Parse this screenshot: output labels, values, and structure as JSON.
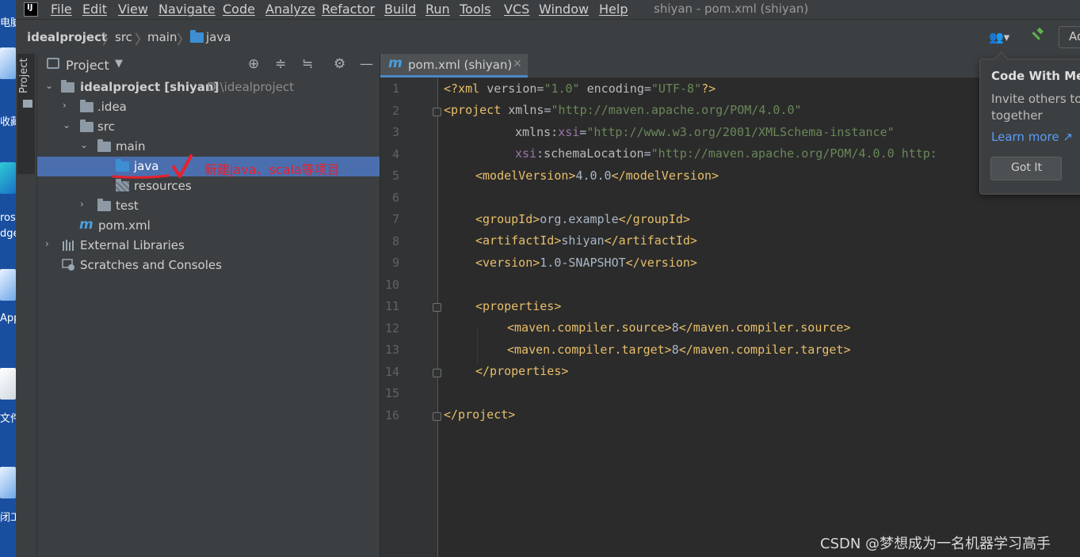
{
  "desktop": {
    "labels": [
      "电脑",
      "收藏",
      "ros",
      "dge",
      "App",
      "文件",
      "闭工"
    ]
  },
  "menubar": {
    "items": [
      "File",
      "Edit",
      "View",
      "Navigate",
      "Code",
      "Analyze",
      "Refactor",
      "Build",
      "Run",
      "Tools",
      "VCS",
      "Window",
      "Help"
    ],
    "window_title": "shiyan - pom.xml (shiyan)"
  },
  "navbar": {
    "breadcrumbs": [
      "idealproject",
      "src",
      "main",
      "java"
    ],
    "add_config_label": "Ad"
  },
  "tool_window_strip": {
    "project_label": "Project"
  },
  "project_panel": {
    "title": "Project",
    "tree": {
      "root_label": "idealproject [shiyan]",
      "root_path": "D:\\idealproject",
      "idea": ".idea",
      "src": "src",
      "main": "main",
      "java": "java",
      "resources": "resources",
      "test": "test",
      "pom": "pom.xml",
      "external_libraries": "External Libraries",
      "scratches": "Scratches and Consoles"
    },
    "annotation_text": "新建java、scala等项目"
  },
  "editor": {
    "tab_label": "pom.xml (shiyan)",
    "line_numbers": [
      "1",
      "2",
      "3",
      "4",
      "5",
      "6",
      "7",
      "8",
      "9",
      "10",
      "11",
      "12",
      "13",
      "14",
      "15",
      "16"
    ],
    "code": {
      "l1": [
        "<?xml ",
        "version",
        "=",
        "\"1.0\"",
        " encoding",
        "=",
        "\"UTF-8\"",
        "?>"
      ],
      "l2": [
        "<project ",
        "xmlns",
        "=",
        "\"http://maven.apache.org/POM/4.0.0\""
      ],
      "l3": [
        "xmlns",
        ":",
        "xsi",
        "=",
        "\"http://www.w3.org/2001/XMLSchema-instance\""
      ],
      "l4": [
        "xsi",
        ":",
        "schemaLocation",
        "=",
        "\"http://maven.apache.org/POM/4.0.0 http:"
      ],
      "l5": [
        "<modelVersion>",
        "4.0.0",
        "</modelVersion>"
      ],
      "l7": [
        "<groupId>",
        "org.example",
        "</groupId>"
      ],
      "l8": [
        "<artifactId>",
        "shiyan",
        "</artifactId>"
      ],
      "l9": [
        "<version>",
        "1.0-SNAPSHOT",
        "</version>"
      ],
      "l11": [
        "<properties>"
      ],
      "l12": [
        "<maven.compiler.source>",
        "8",
        "</maven.compiler.source>"
      ],
      "l13": [
        "<maven.compiler.target>",
        "8",
        "</maven.compiler.target>"
      ],
      "l14": [
        "</properties>"
      ],
      "l16": [
        "</project>"
      ]
    }
  },
  "popup": {
    "title": "Code With Me",
    "body": "Invite others to work together",
    "link": "Learn more ↗",
    "button": "Got It"
  },
  "watermark": "CSDN @梦想成为一名机器学习高手",
  "colors": {
    "selection": "#4b6eaf",
    "xml_tag": "#e8bf6a",
    "xml_string": "#6a8759",
    "xml_namespace": "#9876aa",
    "annotation_red": "#e8212c",
    "link_blue": "#589df6"
  }
}
